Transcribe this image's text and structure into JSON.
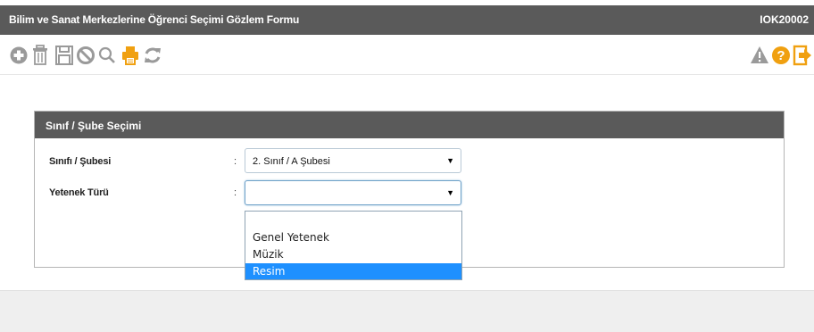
{
  "window": {
    "title": "Bilim ve Sanat Merkezlerine Öğrenci Seçimi Gözlem Formu",
    "form_code": "IOK20002"
  },
  "toolbar": {
    "left_icons": [
      "add-icon",
      "trash-icon",
      "save-icon",
      "cancel-icon",
      "search-icon",
      "print-icon",
      "refresh-icon"
    ],
    "right_icons": [
      "warning-icon",
      "help-icon",
      "exit-icon"
    ]
  },
  "panel": {
    "title": "Sınıf / Şube Seçimi",
    "fields": [
      {
        "label": "Sınıfı / Şubesi",
        "colon": ":",
        "value": "2. Sınıf / A Şubesi"
      },
      {
        "label": "Yetenek Türü",
        "colon": ":",
        "value": ""
      }
    ]
  },
  "dropdown": {
    "options": [
      "",
      "Genel Yetenek",
      "Müzik",
      "Resim"
    ],
    "highlighted": "Resim"
  },
  "colors": {
    "header_bg": "#5a5a5a",
    "accent_orange": "#f0a010",
    "icon_gray": "#9a9a9a",
    "highlight_blue": "#1e90ff"
  }
}
